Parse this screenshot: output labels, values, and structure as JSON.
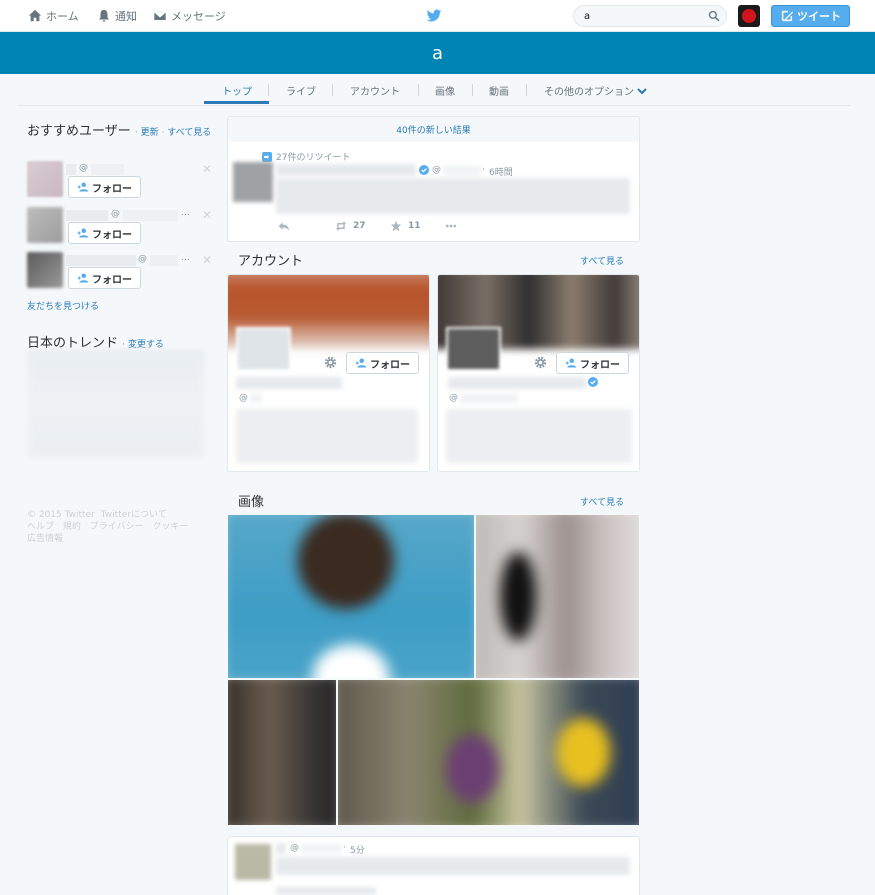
{
  "nav": {
    "home": "ホーム",
    "notifications": "通知",
    "messages": "メッセージ",
    "search_value": "a",
    "tweet_button": "ツイート"
  },
  "banner": {
    "query": "a"
  },
  "tabs": [
    {
      "label": "トップ",
      "active": true
    },
    {
      "label": "ライブ"
    },
    {
      "label": "アカウント"
    },
    {
      "label": "画像"
    },
    {
      "label": "動画"
    },
    {
      "label": "その他のオプション"
    }
  ],
  "who_to_follow": {
    "title": "おすすめユーザー",
    "refresh": "更新",
    "view_all": "すべて見る",
    "follow_label": "フォロー",
    "users": [
      {
        "handle_prefix": "@"
      },
      {
        "handle_prefix": "@"
      },
      {
        "handle_prefix": "@"
      }
    ],
    "find_friends": "友だちを見つける"
  },
  "trends": {
    "title": "日本のトレンド",
    "change": "変更する"
  },
  "footer": {
    "copyright": "© 2015 Twitter",
    "links": [
      "Twitterについて",
      "ヘルプ",
      "規約",
      "プライバシー",
      "クッキー",
      "広告情報"
    ]
  },
  "results": {
    "new_results": "40件の新しい結果",
    "top_tweet": {
      "retweet_label": "27件のリツイート",
      "handle_prefix": "@",
      "time": "6時間",
      "retweets": "27",
      "favorites": "11"
    },
    "accounts": {
      "title": "アカウント",
      "view_all": "すべて見る",
      "follow_label": "フォロー",
      "items": [
        {
          "handle_prefix": "@"
        },
        {
          "handle_prefix": "@"
        }
      ]
    },
    "images": {
      "title": "画像",
      "view_all": "すべて見る"
    },
    "bottom_tweet": {
      "handle_prefix": "@",
      "time": "5分"
    }
  },
  "colors": {
    "brand": "#0084b4",
    "link": "#2b7bb9",
    "tweet_button": "#55acee",
    "background": "#f5f8fa"
  },
  "icons": [
    "home-icon",
    "bell-icon",
    "envelope-icon",
    "twitter-bird-icon",
    "search-icon",
    "compose-icon",
    "follow-person-icon",
    "close-icon",
    "retweet-icon",
    "reply-icon",
    "star-icon",
    "more-icon",
    "verified-icon",
    "gear-icon",
    "chevron-down-icon"
  ]
}
